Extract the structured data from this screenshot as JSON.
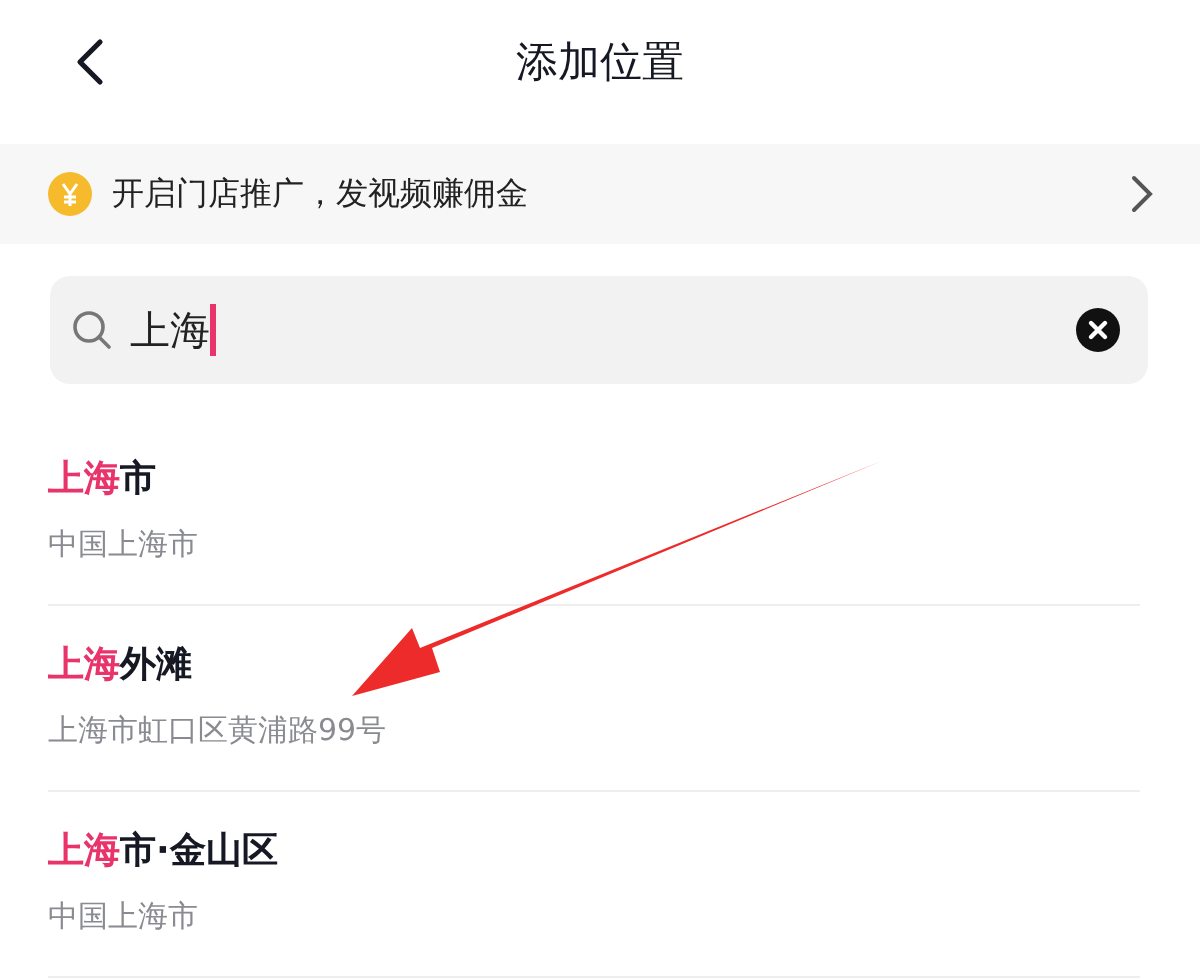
{
  "header": {
    "title": "添加位置"
  },
  "banner": {
    "text": "开启门店推广，发视频赚佣金"
  },
  "search": {
    "value": "上海"
  },
  "results": [
    {
      "match": "上海",
      "rest": "市",
      "address": "中国上海市"
    },
    {
      "match": "上海",
      "rest": "外滩",
      "address": "上海市虹口区黄浦路99号"
    },
    {
      "match": "上海",
      "rest": "市·金山区",
      "address": "中国上海市"
    }
  ]
}
